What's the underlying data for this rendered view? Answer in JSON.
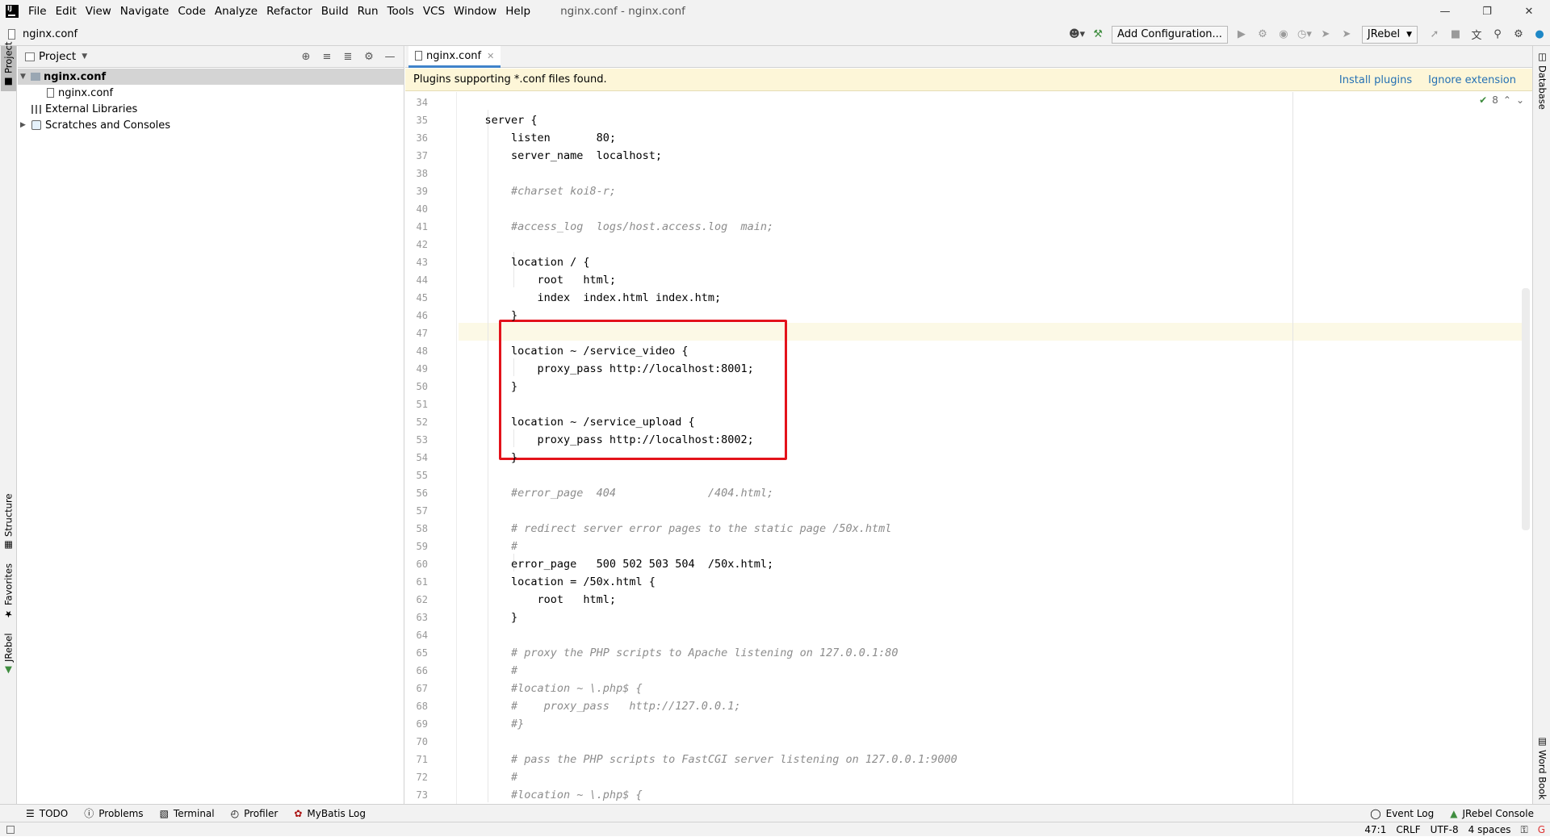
{
  "menubar": {
    "items": [
      "File",
      "Edit",
      "View",
      "Navigate",
      "Code",
      "Analyze",
      "Refactor",
      "Build",
      "Run",
      "Tools",
      "VCS",
      "Window",
      "Help"
    ],
    "window_title": "nginx.conf - nginx.conf"
  },
  "navbar": {
    "breadcrumb": "nginx.conf",
    "add_configuration": "Add Configuration...",
    "jrebel_select": "JRebel"
  },
  "left_strip": {
    "project": "Project",
    "structure": "Structure",
    "favorites": "Favorites",
    "jrebel": "JRebel"
  },
  "right_strip": {
    "database": "Database",
    "word_book": "Word Book"
  },
  "project_panel": {
    "title": "Project",
    "tree": [
      {
        "label": "nginx.conf"
      },
      {
        "label": "nginx.conf"
      },
      {
        "label": "External Libraries"
      },
      {
        "label": "Scratches and Consoles"
      }
    ]
  },
  "editor": {
    "tab_label": "nginx.conf",
    "banner_message": "Plugins supporting *.conf files found.",
    "install_plugins": "Install plugins",
    "ignore_extension": "Ignore extension",
    "inspection_count": "8",
    "lines": [
      {
        "n": "34",
        "t": "",
        "c": ""
      },
      {
        "n": "35",
        "t": "    server {",
        "c": ""
      },
      {
        "n": "36",
        "t": "        listen       80;",
        "c": ""
      },
      {
        "n": "37",
        "t": "        server_name  localhost;",
        "c": ""
      },
      {
        "n": "38",
        "t": "",
        "c": ""
      },
      {
        "n": "39",
        "t": "        #charset koi8-r;",
        "c": "cmt"
      },
      {
        "n": "40",
        "t": "",
        "c": ""
      },
      {
        "n": "41",
        "t": "        #access_log  logs/host.access.log  main;",
        "c": "cmt"
      },
      {
        "n": "42",
        "t": "",
        "c": ""
      },
      {
        "n": "43",
        "t": "        location / {",
        "c": ""
      },
      {
        "n": "44",
        "t": "            root   html;",
        "c": ""
      },
      {
        "n": "45",
        "t": "            index  index.html index.htm;",
        "c": ""
      },
      {
        "n": "46",
        "t": "        }",
        "c": ""
      },
      {
        "n": "47",
        "t": "",
        "c": ""
      },
      {
        "n": "48",
        "t": "        location ~ /service_video {",
        "c": ""
      },
      {
        "n": "49",
        "t": "            proxy_pass http://localhost:8001;",
        "c": ""
      },
      {
        "n": "50",
        "t": "        }",
        "c": ""
      },
      {
        "n": "51",
        "t": "",
        "c": ""
      },
      {
        "n": "52",
        "t": "        location ~ /service_upload {",
        "c": ""
      },
      {
        "n": "53",
        "t": "            proxy_pass http://localhost:8002;",
        "c": ""
      },
      {
        "n": "54",
        "t": "        }",
        "c": ""
      },
      {
        "n": "55",
        "t": "",
        "c": ""
      },
      {
        "n": "56",
        "t": "        #error_page  404              /404.html;",
        "c": "cmt"
      },
      {
        "n": "57",
        "t": "",
        "c": ""
      },
      {
        "n": "58",
        "t": "        # redirect server error pages to the static page /50x.html",
        "c": "cmt"
      },
      {
        "n": "59",
        "t": "        #",
        "c": "cmt"
      },
      {
        "n": "60",
        "t": "        error_page   500 502 503 504  /50x.html;",
        "c": ""
      },
      {
        "n": "61",
        "t": "        location = /50x.html {",
        "c": ""
      },
      {
        "n": "62",
        "t": "            root   html;",
        "c": ""
      },
      {
        "n": "63",
        "t": "        }",
        "c": ""
      },
      {
        "n": "64",
        "t": "",
        "c": ""
      },
      {
        "n": "65",
        "t": "        # proxy the PHP scripts to Apache listening on 127.0.0.1:80",
        "c": "cmt"
      },
      {
        "n": "66",
        "t": "        #",
        "c": "cmt"
      },
      {
        "n": "67",
        "t": "        #location ~ \\.php$ {",
        "c": "cmt"
      },
      {
        "n": "68",
        "t": "        #    proxy_pass   http://127.0.0.1;",
        "c": "cmt"
      },
      {
        "n": "69",
        "t": "        #}",
        "c": "cmt"
      },
      {
        "n": "70",
        "t": "",
        "c": ""
      },
      {
        "n": "71",
        "t": "        # pass the PHP scripts to FastCGI server listening on 127.0.0.1:9000",
        "c": "cmt"
      },
      {
        "n": "72",
        "t": "        #",
        "c": "cmt"
      },
      {
        "n": "73",
        "t": "        #location ~ \\.php$ {",
        "c": "cmt"
      }
    ]
  },
  "bottom_tools": {
    "todo": "TODO",
    "problems": "Problems",
    "terminal": "Terminal",
    "profiler": "Profiler",
    "mybatis": "MyBatis Log",
    "event_log": "Event Log",
    "jrebel_console": "JRebel Console"
  },
  "status": {
    "position": "47:1",
    "line_sep": "CRLF",
    "encoding": "UTF-8",
    "indent": "4 spaces"
  },
  "colors": {
    "highlight_box": "#e3131b",
    "banner_bg": "#fdf6d8",
    "link": "#2470b3"
  }
}
